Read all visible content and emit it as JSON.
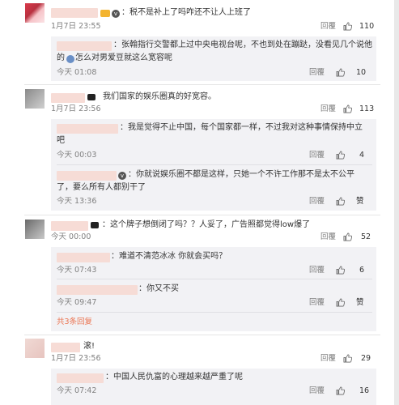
{
  "comments": [
    {
      "text": "：税不是补上了吗咋还不让人上班了",
      "time": "1月7日 23:55",
      "reply": "回覆",
      "likes": "110"
    },
    {
      "text": "我们国家的娱乐圈真的好宽容。",
      "time": "1月7日 23:56",
      "reply": "回覆",
      "likes": "113",
      "replies": [
        {
          "text_line1": "：我是觉得不止中国，每个国家都一样，不过我对这种事情保持中立",
          "text_line2": "吧",
          "time": "今天 00:03",
          "reply": "回覆",
          "likes": "4"
        },
        {
          "text_line1": "：你就说娱乐圈不都是这样，只她一个不许工作那不是太不公平",
          "text_line2": "了，要么所有人都别干了",
          "time": "今天 13:36",
          "reply": "回覆",
          "likes": "赞"
        }
      ]
    },
    {
      "text": "：这个牌子想倒闭了吗？？人妥了，广告照都觉得low爆了",
      "time": "今天 00:00",
      "reply": "回覆",
      "likes": "52",
      "replies": [
        {
          "text": "：难道不清范冰冰  你就会买吗？",
          "time": "今天 07:43",
          "reply": "回覆",
          "likes": "6"
        },
        {
          "text": "：你又不买",
          "time": "今天 09:47",
          "reply": "回覆",
          "likes": "赞"
        }
      ],
      "more_replies": "共3条回复"
    },
    {
      "text": "滚!",
      "time": "1月7日 23:56",
      "reply": "回覆",
      "likes": "29",
      "replies": [
        {
          "text": "：中国人民仇富的心理越来越严重了呢",
          "time": "今天 07:42",
          "reply": "回覆",
          "likes": "16"
        }
      ]
    }
  ],
  "top_reply": {
    "text_line1": "：张翰指行交警都上过中央电视台呢，不也到处在蹦跶，没看见几个说他",
    "text_line2": "的",
    "text_line2b": "怎么对男爱豆就这么宽容呢",
    "time": "今天 01:08",
    "reply": "回覆",
    "likes": "10"
  },
  "colors": {
    "accent": "#eb7350",
    "reply_bg": "#f2f2f5",
    "muted": "#808080"
  },
  "icons": {
    "like": "thumbs-up-icon",
    "vip": "vip-badge-icon"
  }
}
